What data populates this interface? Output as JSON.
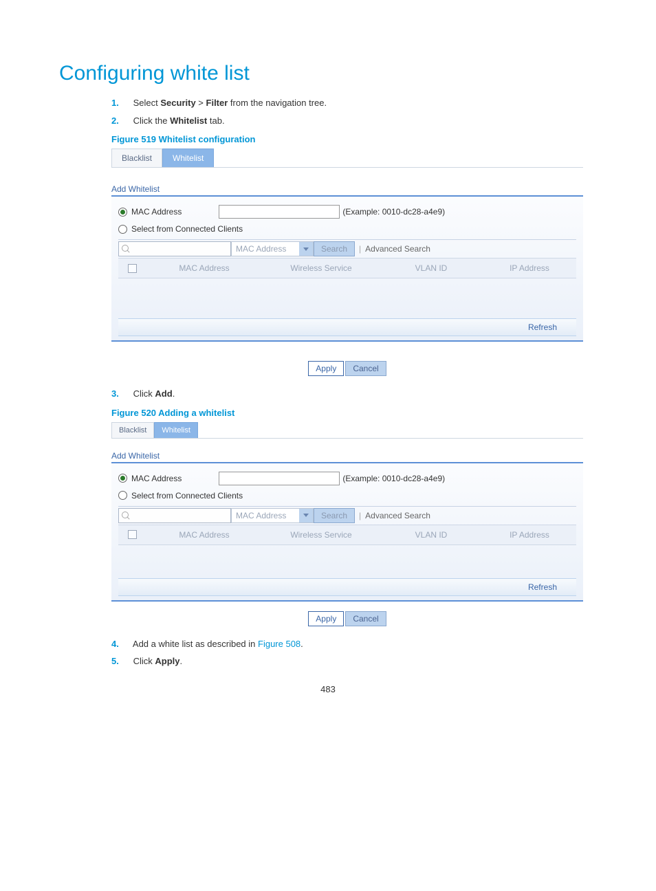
{
  "title": "Configuring white list",
  "steps": {
    "s1_pre": "Select ",
    "s1_sec": "Security",
    "s1_gt": " > ",
    "s1_filt": "Filter",
    "s1_post": " from the navigation tree.",
    "s2_pre": "Click the ",
    "s2_tab": "Whitelist",
    "s2_post": " tab.",
    "s3_pre": "Click ",
    "s3_add": "Add",
    "s3_post": ".",
    "s4_pre": "Add a white list as described in ",
    "s4_link": "Figure 508",
    "s4_post": ".",
    "s5_pre": "Click ",
    "s5_apply": "Apply",
    "s5_post": "."
  },
  "fig519": {
    "caption": "Figure 519 Whitelist configuration",
    "tabs": {
      "blacklist": "Blacklist",
      "whitelist": "Whitelist"
    },
    "panel_label": "Add Whitelist",
    "radio_mac": "MAC Address",
    "radio_clients": "Select from Connected Clients",
    "example": "(Example: 0010-dc28-a4e9)",
    "select_label": "MAC Address",
    "search_btn": "Search",
    "adv_search": "Advanced Search",
    "cols": {
      "mac": "MAC Address",
      "ws": "Wireless Service",
      "vlan": "VLAN ID",
      "ip": "IP Address"
    },
    "refresh": "Refresh",
    "apply": "Apply",
    "cancel": "Cancel"
  },
  "fig520": {
    "caption": "Figure 520 Adding a whitelist",
    "tabs": {
      "blacklist": "Blacklist",
      "whitelist": "Whitelist"
    },
    "panel_label": "Add Whitelist",
    "radio_mac": "MAC Address",
    "radio_clients": "Select from Connected Clients",
    "example": "(Example: 0010-dc28-a4e9)",
    "select_label": "MAC Address",
    "search_btn": "Search",
    "adv_search": "Advanced Search",
    "cols": {
      "mac": "MAC Address",
      "ws": "Wireless Service",
      "vlan": "VLAN ID",
      "ip": "IP Address"
    },
    "refresh": "Refresh",
    "apply": "Apply",
    "cancel": "Cancel"
  },
  "page_number": "483"
}
